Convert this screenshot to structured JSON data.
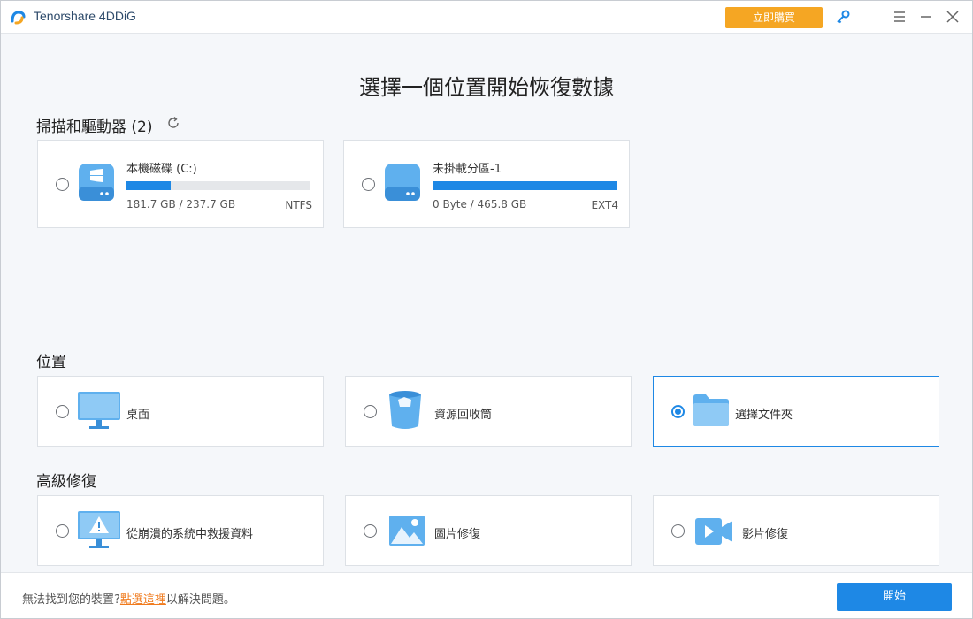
{
  "app": {
    "title": "Tenorshare 4DDiG",
    "buy_label": "立即購買"
  },
  "page": {
    "title": "選擇一個位置開始恢復數據"
  },
  "drives_section": {
    "title": "掃描和驅動器 (2)",
    "drives": [
      {
        "name": "本機磁碟 (C:)",
        "size_text": "181.7 GB / 237.7 GB",
        "fs": "NTFS",
        "used_fraction": 0.24,
        "selected": false
      },
      {
        "name": "未掛載分區-1",
        "size_text": "0 Byte / 465.8 GB",
        "fs": "EXT4",
        "used_fraction": 1.0,
        "selected": false
      }
    ]
  },
  "locations_section": {
    "title": "位置",
    "items": [
      {
        "label": "桌面",
        "icon": "desktop-icon",
        "selected": false
      },
      {
        "label": "資源回收筒",
        "icon": "recycle-bin-icon",
        "selected": false
      },
      {
        "label": "選擇文件夾",
        "icon": "folder-icon",
        "selected": true
      }
    ]
  },
  "advanced_section": {
    "title": "高級修復",
    "items": [
      {
        "label": "從崩潰的系統中救援資料",
        "icon": "crashed-system-icon",
        "selected": false
      },
      {
        "label": "圖片修復",
        "icon": "photo-repair-icon",
        "selected": false
      },
      {
        "label": "影片修復",
        "icon": "video-repair-icon",
        "selected": false
      }
    ]
  },
  "footer": {
    "help_prefix": "無法找到您的裝置?",
    "help_link": "點選這裡",
    "help_suffix": "以解決問題。",
    "start_label": "開始"
  },
  "colors": {
    "accent": "#1e88e5",
    "buy": "#f5a623",
    "link": "#f07a1c"
  }
}
